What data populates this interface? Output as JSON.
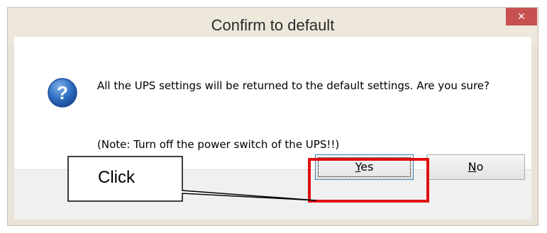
{
  "dialog": {
    "title": "Confirm to default",
    "close_glyph": "×",
    "icon": "question-icon",
    "message": "All the UPS settings will be returned to the default settings. Are you sure?",
    "note": "(Note: Turn off the power switch of the UPS!!)",
    "buttons": {
      "yes_accel": "Y",
      "yes_rest": "es",
      "no_accel": "N",
      "no_rest": "o"
    }
  },
  "annotation": {
    "callout_text": "Click",
    "highlight_color": "#e01010"
  }
}
